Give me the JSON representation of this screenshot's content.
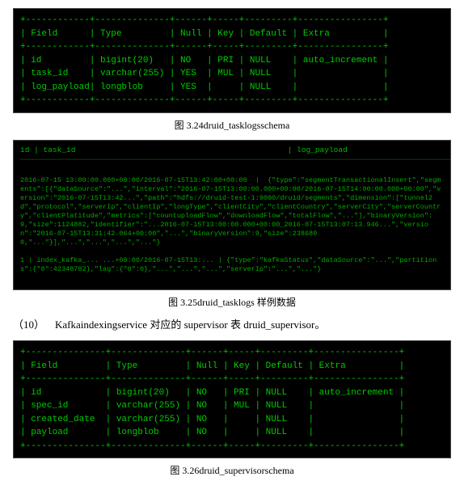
{
  "section1": {
    "terminal_content": "+------------+--------------+------+-----+---------+----------------+\n| Field      | Type         | Null | Key | Default | Extra          |\n+------------+--------------+------+-----+---------+----------------+\n| id         | bigint(20)   | NO   | PRI | NULL    | auto_increment |\n| task_id    | varchar(255) | YES  | MUL | NULL    |                |\n| log_payload| longblob     | YES  |     | NULL    |                |\n+------------+--------------+------+-----+---------+----------------+",
    "caption": "图 3.24druid_tasklogsschema"
  },
  "section2": {
    "terminal_content": "id | task_id                                        | log_payload\n\n\n\n\n\n\n\n\n\n1 | index_kafk... ...000+00:00/2016-07-15T13:... | {\"type\":\"segmentTransactionalInsert\",\"segments\":[{\"dataSource\":\"...  \"interval\":\n\"2016-07-15T13:00:00.000+00:00/2016-07-15T14:00:00.000+00:00\",\"version\":\"2016-07-15T13:42...\",\"path\":\"hfds://druid-test-1:9000/druid/segments\",\"...\",\"binaryVersion\":9,\"size\":1124892,\"identifier\":\"...2016-07-15T13:00:00.000+00:00_2016-07-15T13... 2015-07-15T13:07:13.946...\",\"version\":\"2016-07-15T13:31:42.064+00:00\",\"...\",\"binaryVersion\":9,\"size\":2386800,\"...\"}],\"...\",\"...\",\"...\",\"...\"}  | {\"type\":\"kafk...  ...serverIp\":\"...\",...}",
    "caption": "图 3.25druid_tasklogs 样例数据"
  },
  "section3": {
    "paragraph_num": "（10）",
    "paragraph_text": "Kafkaindexingservice 对应的 supervisor 表 druid_supervisor。",
    "terminal_content": "+---------------+--------------+------+-----+---------+----------------+\n| Field         | Type         | Null | Key | Default | Extra          |\n+---------------+--------------+------+-----+---------+----------------+\n| id            | bigint(20)   | NO   | PRI | NULL    | auto_increment |\n| spec_id       | varchar(255) | NO   | MUL | NULL    |                |\n| created_date  | varchar(255) | NO   |     | NULL    |                |\n| payload       | longblob     | NO   |     | NULL    |                |\n+---------------+--------------+------+-----+---------+----------------+",
    "caption": "图 3.26druid_supervisorschema"
  }
}
